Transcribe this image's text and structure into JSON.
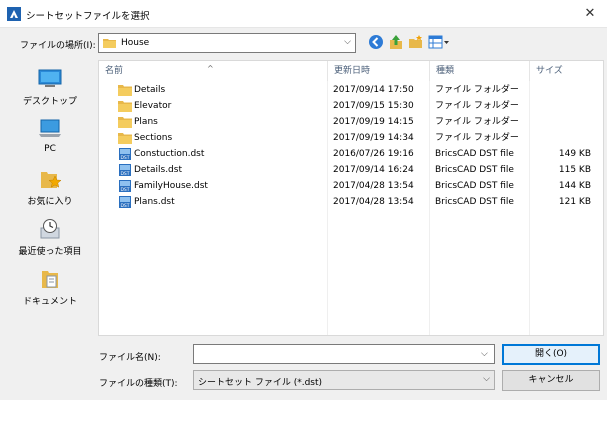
{
  "window": {
    "title": "シートセットファイルを選択",
    "close": "✕"
  },
  "lookin": {
    "label": "ファイルの場所(I):",
    "value": "House"
  },
  "places": [
    {
      "label": "デスクトップ"
    },
    {
      "label": "PC"
    },
    {
      "label": "お気に入り"
    },
    {
      "label": "最近使った項目"
    },
    {
      "label": "ドキュメント"
    }
  ],
  "columns": {
    "name": "名前",
    "date": "更新日時",
    "type": "種類",
    "size": "サイズ"
  },
  "files": [
    {
      "name": "Details",
      "date": "2017/09/14 17:50",
      "type": "ファイル フォルダー",
      "size": "",
      "kind": "folder"
    },
    {
      "name": "Elevator",
      "date": "2017/09/15 15:30",
      "type": "ファイル フォルダー",
      "size": "",
      "kind": "folder"
    },
    {
      "name": "Plans",
      "date": "2017/09/19 14:15",
      "type": "ファイル フォルダー",
      "size": "",
      "kind": "folder"
    },
    {
      "name": "Sections",
      "date": "2017/09/19 14:34",
      "type": "ファイル フォルダー",
      "size": "",
      "kind": "folder"
    },
    {
      "name": "Constuction.dst",
      "date": "2016/07/26 19:16",
      "type": "BricsCAD DST file",
      "size": "149 KB",
      "kind": "dst"
    },
    {
      "name": "Details.dst",
      "date": "2017/09/14 16:24",
      "type": "BricsCAD DST file",
      "size": "115 KB",
      "kind": "dst"
    },
    {
      "name": "FamilyHouse.dst",
      "date": "2017/04/28 13:54",
      "type": "BricsCAD DST file",
      "size": "144 KB",
      "kind": "dst"
    },
    {
      "name": "Plans.dst",
      "date": "2017/04/28 13:54",
      "type": "BricsCAD DST file",
      "size": "121 KB",
      "kind": "dst"
    }
  ],
  "filename": {
    "label": "ファイル名(N):",
    "value": ""
  },
  "filetype": {
    "label": "ファイルの種類(T):",
    "value": "シートセット ファイル (*.dst)"
  },
  "buttons": {
    "open": "開く(O)",
    "cancel": "キャンセル"
  },
  "colors": {
    "accent": "#0078d7",
    "folder": "#e8b84a"
  }
}
